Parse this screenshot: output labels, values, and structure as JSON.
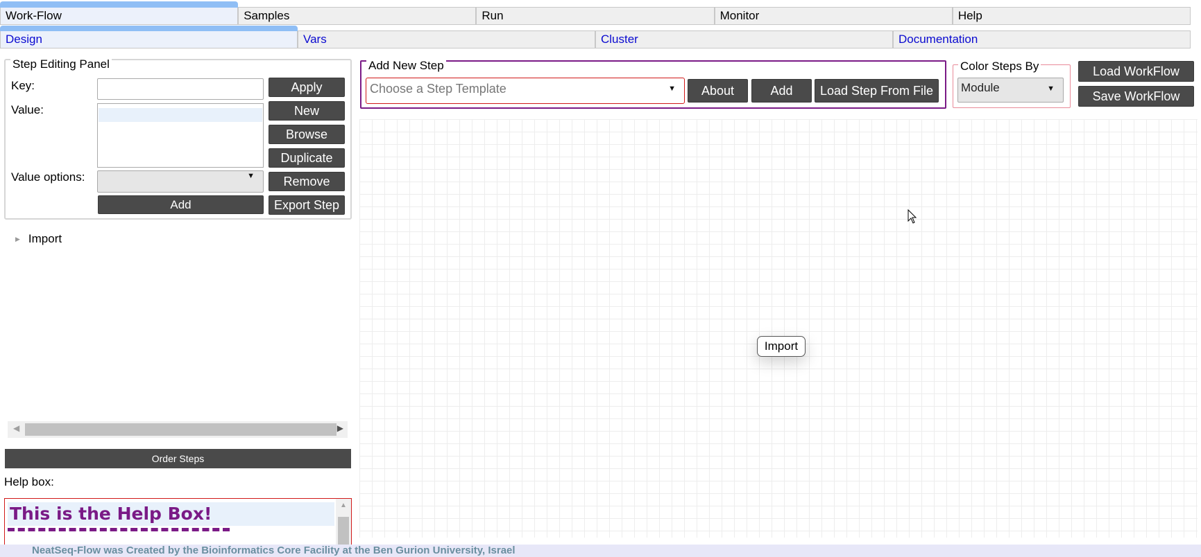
{
  "main_tabs": [
    {
      "label": "Work-Flow",
      "active": true
    },
    {
      "label": "Samples",
      "active": false
    },
    {
      "label": "Run",
      "active": false
    },
    {
      "label": "Monitor",
      "active": false
    },
    {
      "label": "Help",
      "active": false
    }
  ],
  "sub_tabs": [
    {
      "label": "Design",
      "active": true
    },
    {
      "label": "Vars",
      "active": false
    },
    {
      "label": "Cluster",
      "active": false
    },
    {
      "label": "Documentation",
      "active": false
    }
  ],
  "step_panel": {
    "legend": "Step Editing Panel",
    "key_label": "Key:",
    "key_value": "",
    "value_label": "Value:",
    "value_options_label": "Value options:",
    "value_options_selected": "",
    "add_label": "Add",
    "buttons": {
      "apply": "Apply",
      "new": "New",
      "browse": "Browse",
      "duplicate": "Duplicate",
      "remove": "Remove",
      "export_step": "Export Step"
    }
  },
  "tree": {
    "items": [
      {
        "label": "Import",
        "expanded": false
      }
    ]
  },
  "order_steps_label": "Order Steps",
  "help": {
    "label": "Help box:",
    "title": "This is the Help Box!"
  },
  "add_new_step": {
    "legend": "Add New Step",
    "template_placeholder": "Choose a Step Template",
    "about_label": "About",
    "add_label": "Add",
    "load_from_file_label": "Load Step From File"
  },
  "color_steps": {
    "legend": "Color Steps By",
    "selected": "Module"
  },
  "workflow_buttons": {
    "load": "Load WorkFlow",
    "save": "Save WorkFlow"
  },
  "canvas": {
    "nodes": [
      {
        "label": "Import"
      }
    ]
  },
  "footer": "NeatSeq-Flow was Created by the Bioinformatics Core Facility at the Ben Gurion University, Israel",
  "colors": {
    "accent_tab": "#8fbef5",
    "dark_button": "#4a4a4a",
    "add_step_border": "#7a1a86",
    "help_title": "#7a1a86",
    "footer_text": "#6a8fa0"
  }
}
